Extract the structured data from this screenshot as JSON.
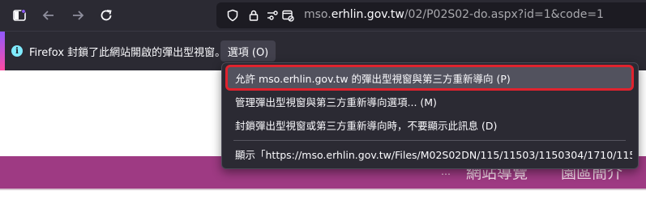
{
  "browser": {
    "url_prefix": "mso.",
    "url_host": "erhlin.gov.tw",
    "url_path": "/02/P02S02-do.aspx?id=1&code=1"
  },
  "notification": {
    "message": "Firefox 封鎖了此網站開啟的彈出型視窗。",
    "options_label": "選項 (O)"
  },
  "menu": {
    "allow": "允許 mso.erhlin.gov.tw 的彈出型視窗與第三方重新導向 (P)",
    "manage": "管理彈出型視窗與第三方重新導向選項... (M)",
    "dont_show": "封鎖彈出型視窗或第三方重新導向時，不要顯示此訊息 (D)",
    "show_link": "顯示「https://mso.erhlin.gov.tw/Files/M02S02DN/115/11503/1150304/1710/115%..."
  },
  "page": {
    "nav_sitemap": "網站導覽",
    "nav_intro": "園區簡介"
  },
  "colors": {
    "toolbar_bg": "#2b2a33",
    "page_band": "#9e3a83",
    "highlight_border": "#e0232e"
  }
}
